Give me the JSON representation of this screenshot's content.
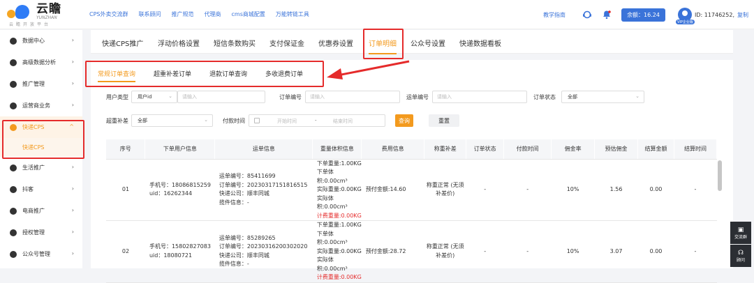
{
  "brand": {
    "name_cn": "云瞻",
    "name_en": "YUNZHAN",
    "slogan": "云瞻开放平台"
  },
  "topnav": [
    "CPS外卖交流群",
    "联系顾问",
    "推广规范",
    "代理商",
    "cms商城配置",
    "万能转链工具"
  ],
  "topright": {
    "guide": "教学指南",
    "balance": "余额：16.24",
    "id_label": "ID: 11746252,",
    "copy": "复制",
    "badge": "VIP企业版"
  },
  "sidebar": [
    {
      "label": "数据中心",
      "chev": "›"
    },
    {
      "label": "高级数据分析",
      "chev": "›"
    },
    {
      "label": "推广管理",
      "chev": "›"
    },
    {
      "label": "运营商业务",
      "chev": "›"
    },
    {
      "label": "快递CPS",
      "chev": "^",
      "sub": "快递CPS"
    },
    {
      "label": "生活推广",
      "chev": "›"
    },
    {
      "label": "抖客",
      "chev": "›"
    },
    {
      "label": "电商推广",
      "chev": "›"
    },
    {
      "label": "授权管理",
      "chev": "›"
    },
    {
      "label": "公众号管理",
      "chev": "›"
    }
  ],
  "tabs": [
    "快递CPS推广",
    "浮动价格设置",
    "短信条数购买",
    "支付保证金",
    "优惠券设置",
    "订单明细",
    "公众号设置",
    "快递数据看板"
  ],
  "subtabs": [
    "常规订单查询",
    "超重补差订单",
    "退款订单查询",
    "多收退费订单"
  ],
  "filters": {
    "user_type_label": "用户类型",
    "user_type_value": "用户id",
    "user_type_placeholder": "请输入",
    "order_no_label": "订单编号",
    "order_no_placeholder": "请输入",
    "waybill_label": "运单编号",
    "waybill_placeholder": "请输入",
    "status_label": "订单状态",
    "status_value": "全部",
    "overweight_label": "超重补差",
    "overweight_value": "全部",
    "paytime_label": "付款时间",
    "start_placeholder": "开始时间",
    "dash": "-",
    "end_placeholder": "结束时间",
    "query": "查询",
    "reset": "重置"
  },
  "table": {
    "headers": [
      "序号",
      "下单用户信息",
      "运单信息",
      "重量体积信息",
      "费用信息",
      "称重补差",
      "订单状态",
      "付款时间",
      "佣金率",
      "预估佣金",
      "结算金额",
      "结算时间"
    ],
    "rows": [
      {
        "idx": "01",
        "user": [
          "手机号：18086815259",
          "uid：16262344"
        ],
        "waybill": [
          "运单编号：85411699",
          "订单编号：20230317151816515",
          "快递公司：顺丰同城",
          "揽件信息：-"
        ],
        "weight": [
          "下单重量:1.00KG",
          "下单体积:0.00cm³",
          "实际重量:0.00KG",
          "实际体积:0.00cm³"
        ],
        "weight_red": "计费重量:0.00KG",
        "fee": "预付金额:14.60",
        "supp": "称重正常 (无须补差价)",
        "status": "-",
        "paytime": "-",
        "rate": "10%",
        "est": "1.56",
        "settle": "0.00",
        "settle_time": "-"
      },
      {
        "idx": "02",
        "user": [
          "手机号：15802827083",
          "uid：18080721"
        ],
        "waybill": [
          "运单编号：85289265",
          "订单编号：20230316200302020",
          "快递公司：顺丰同城",
          "揽件信息：-"
        ],
        "weight": [
          "下单重量:1.00KG",
          "下单体积:0.00cm³",
          "实际重量:0.00KG",
          "实际体积:0.00cm³"
        ],
        "weight_red": "计费重量:0.00KG",
        "fee": "预付金额:28.72",
        "supp": "称重正常 (无须补差价)",
        "status": "-",
        "paytime": "-",
        "rate": "10%",
        "est": "3.07",
        "settle": "0.00",
        "settle_time": "-"
      }
    ]
  },
  "float": [
    "交流群",
    "顾问"
  ]
}
